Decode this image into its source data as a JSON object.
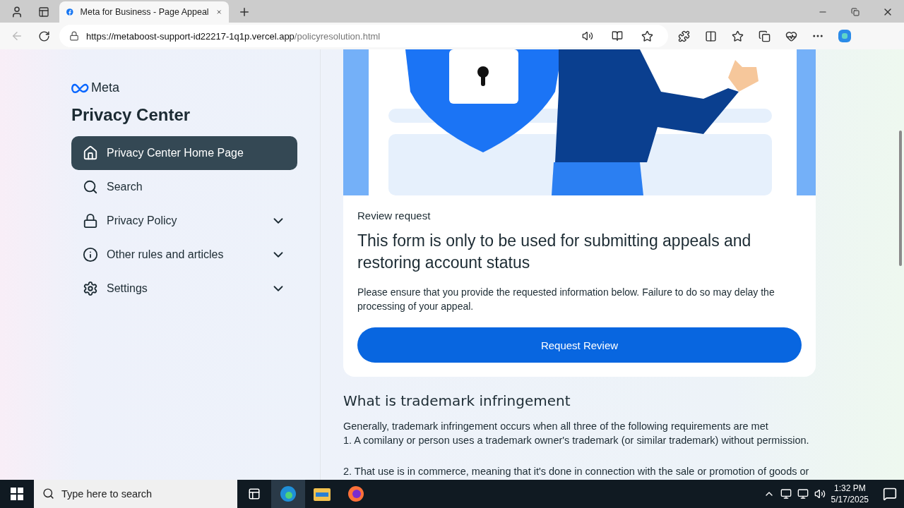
{
  "browser": {
    "tab": {
      "title": "Meta for Business - Page Appeal"
    },
    "url": {
      "host": "https://metaboost-support-id22217-1q1p.vercel.app",
      "path": "/policyresolution.html"
    }
  },
  "sidebar": {
    "logo": "Meta",
    "title": "Privacy Center",
    "items": [
      {
        "label": "Privacy Center Home Page",
        "kind": "home",
        "selected": true,
        "expandable": false
      },
      {
        "label": "Search",
        "kind": "search",
        "selected": false,
        "expandable": false
      },
      {
        "label": "Privacy Policy",
        "kind": "lock",
        "selected": false,
        "expandable": true
      },
      {
        "label": "Other rules and articles",
        "kind": "info",
        "selected": false,
        "expandable": true
      },
      {
        "label": "Settings",
        "kind": "settings",
        "selected": false,
        "expandable": true
      }
    ]
  },
  "card": {
    "eyebrow": "Review request",
    "heading": "This form is only to be used for submitting appeals and restoring account status",
    "body": "Please ensure that you provide the requested information below. Failure to do so may delay the processing of your appeal.",
    "button": "Request Review"
  },
  "article": {
    "heading": "What is trademark infringement",
    "paragraphs": [
      "Generally, trademark infringement occurs when all three of the following requirements are met",
      "1. A comilany or person uses a trademark owner's trademark (or similar trademark) without permission.",
      "2. That use is in commerce, meaning that it's done in connection with the sale or promotion of goods or"
    ]
  },
  "taskbar": {
    "search": {
      "placeholder": "Type here to search"
    },
    "time": "1:32 PM",
    "date": "5/17/2025"
  }
}
